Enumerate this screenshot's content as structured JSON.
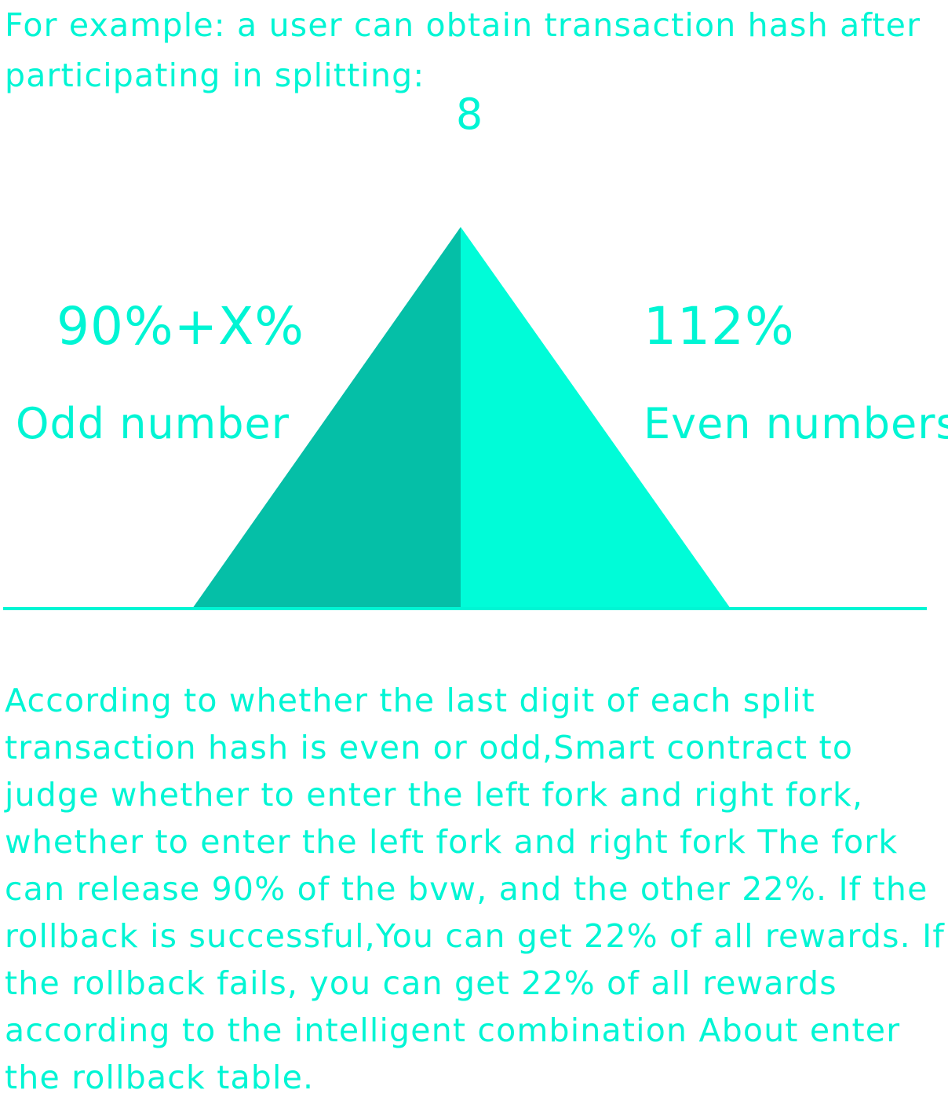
{
  "intro_text": "For example: a user can obtain transaction hash after participating in splitting:",
  "top_number": "8",
  "left_fork": {
    "value": "90%+X%",
    "label": "Odd number",
    "color": "#05bfa7"
  },
  "right_fork": {
    "value": "112%",
    "label": "Even numbers",
    "color": "#00fcd8"
  },
  "accent_color": "#00f5d4",
  "description": "According to whether the last digit of each split transaction hash is even or odd,Smart contract to judge whether to enter the left fork and right fork, whether to enter the left fork and right fork The fork can release 90% of the bvw, and the other 22%. If the rollback is successful,You can get 22% of all rewards. If the rollback fails, you can get 22% of all rewards according to the intelligent combination About enter the rollback table."
}
